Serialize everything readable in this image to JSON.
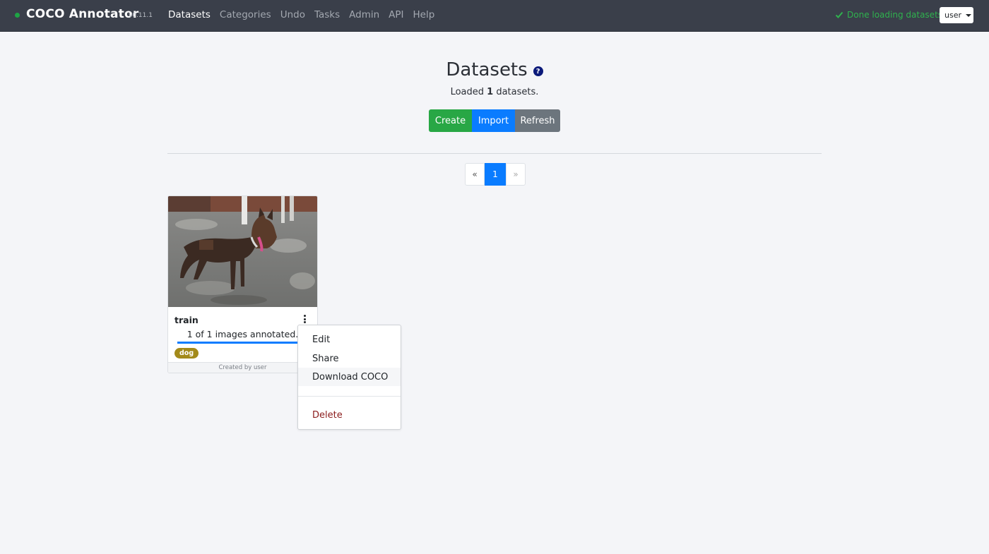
{
  "navbar": {
    "brand": "COCO Annotator",
    "version": "v0.11.1",
    "links": [
      {
        "label": "Datasets",
        "active": true
      },
      {
        "label": "Categories",
        "active": false
      },
      {
        "label": "Undo",
        "active": false
      },
      {
        "label": "Tasks",
        "active": false
      },
      {
        "label": "Admin",
        "active": false
      },
      {
        "label": "API",
        "active": false
      },
      {
        "label": "Help",
        "active": false
      }
    ],
    "status_message": "Done loading datasets",
    "user_label": "user",
    "status_color": "#1ea444"
  },
  "header": {
    "title": "Datasets",
    "help_icon": "question-circle-icon",
    "loaded_prefix": "Loaded",
    "loaded_count": "1",
    "loaded_suffix": "datasets."
  },
  "actions": {
    "create_label": "Create",
    "import_label": "Import",
    "refresh_label": "Refresh",
    "colors": {
      "create": "#28a745",
      "import": "#0a7cff",
      "refresh": "#6c757d"
    }
  },
  "pagination": {
    "prev_label": "«",
    "current_page": "1",
    "next_label": "»"
  },
  "dataset_card": {
    "name": "train",
    "progress_text": "1 of 1 images annotated.",
    "progress_fraction": 1.0,
    "tags": [
      "dog"
    ],
    "footer": "Created by user",
    "menu_icon": "kebab-vertical-icon"
  },
  "dataset_menu": {
    "items": [
      {
        "label": "Edit"
      },
      {
        "label": "Share"
      },
      {
        "label": "Download COCO",
        "hover": true
      }
    ],
    "delete_label": "Delete"
  }
}
